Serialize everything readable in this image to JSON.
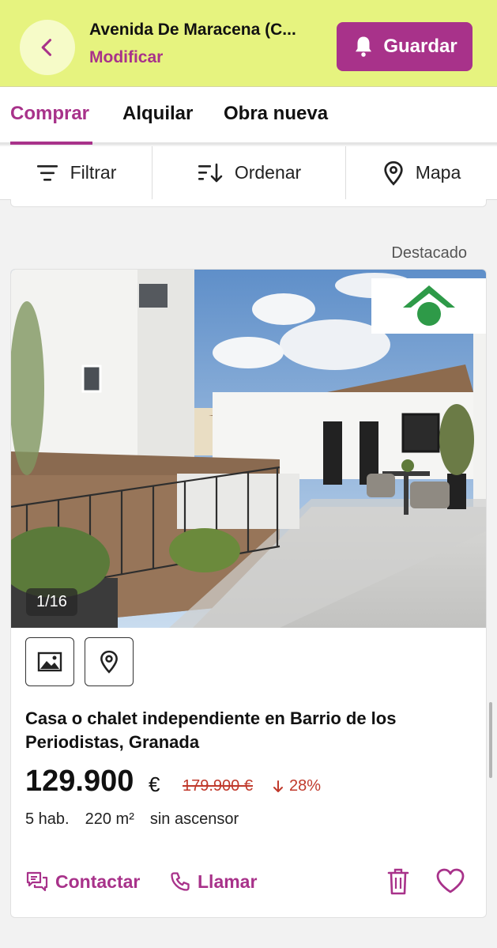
{
  "header": {
    "title": "Avenida De Maracena (C...",
    "subtitle_link": "Modificar",
    "save_label": "Guardar",
    "back_icon": "chevron-left-icon",
    "save_icon": "bell-icon"
  },
  "tabs": [
    {
      "label": "Comprar",
      "active": true
    },
    {
      "label": "Alquilar",
      "active": false
    },
    {
      "label": "Obra nueva",
      "active": false
    }
  ],
  "toolbar": {
    "filter_label": "Filtrar",
    "sort_label": "Ordenar",
    "map_label": "Mapa"
  },
  "listing": {
    "badge": "Destacado",
    "photo_counter": "1/16",
    "title": "Casa o chalet independiente en Barrio de los Periodistas, Granada",
    "price": "129.900",
    "currency": "€",
    "old_price": "179.900 €",
    "discount": "28%",
    "features": [
      "5 hab.",
      "220 m²",
      "sin ascensor"
    ],
    "actions": {
      "contact_label": "Contactar",
      "call_label": "Llamar"
    }
  },
  "colors": {
    "accent": "#a8328a",
    "header_bg": "#e6f37f",
    "price_drop": "#c0392b"
  }
}
